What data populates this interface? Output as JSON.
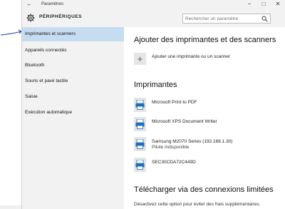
{
  "window": {
    "title": "Paramètres",
    "back_glyph": "←",
    "minimize_glyph": "−",
    "maximize_glyph": "□",
    "close_glyph": "✕"
  },
  "header": {
    "section_title": "PÉRIPHÉRIQUES",
    "icon": "gear-icon",
    "search_placeholder": "Rechercher un paramètre",
    "search_icon": "search-icon"
  },
  "sidebar": {
    "items": [
      {
        "label": "Imprimantes et scanners",
        "active": true
      },
      {
        "label": "Appareils connectés"
      },
      {
        "label": "Bluetooth"
      },
      {
        "label": "Souris et pavé tactile"
      },
      {
        "label": "Saisie"
      },
      {
        "label": "Exécution automatique"
      }
    ]
  },
  "main": {
    "add_heading": "Ajouter des imprimantes et des scanners",
    "add_label": "Ajouter une imprimante ou un scanner",
    "printers_heading": "Imprimantes",
    "printers": [
      {
        "name": "Microsoft Print to PDF",
        "status": "",
        "icon": "pdf-printer-icon"
      },
      {
        "name": "Microsoft XPS Document Writer",
        "status": "",
        "icon": "xps-printer-icon"
      },
      {
        "name": "Samsung M2070 Series (192.168.1.30)",
        "status": "Pilote indisponible",
        "icon": "printer-icon"
      },
      {
        "name": "SEC30CDA72C449D",
        "status": "",
        "icon": "printer-icon"
      }
    ],
    "limited_heading": "Télécharger via des connexions limitées",
    "limited_desc": "Désactivez cette option pour éviter des frais supplémentaires."
  },
  "colors": {
    "accent": "#1a6fc4",
    "sidebar_bg": "#f2f2f2",
    "active_bg": "#c6dcf0",
    "annotation": "#1f3ea8"
  }
}
